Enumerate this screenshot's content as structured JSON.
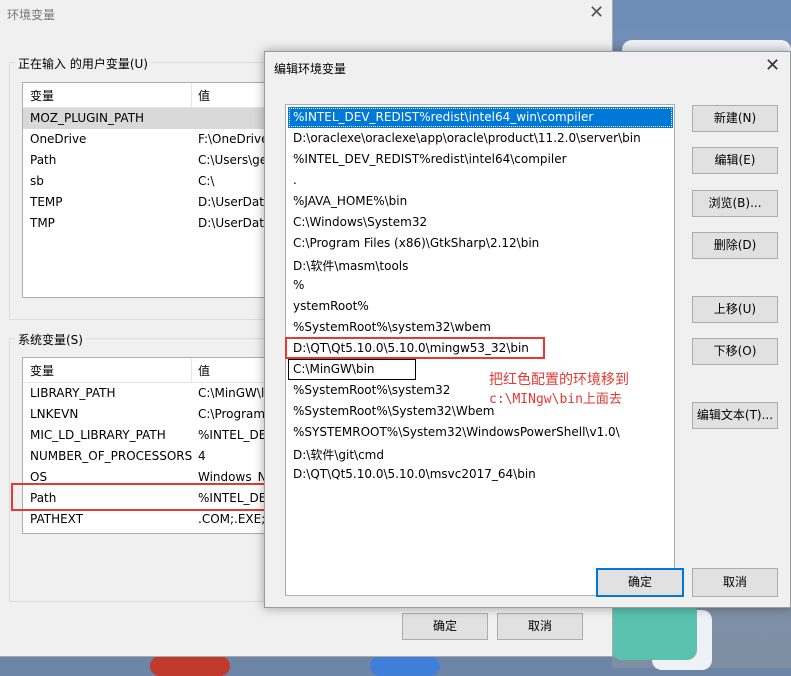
{
  "background_window": {
    "title": "环境变量",
    "close_glyph": "✕",
    "user_group_label": "正在输入 的用户变量(U)",
    "system_group_label": "系统变量(S)",
    "col_variable": "变量",
    "col_value": "值",
    "user_vars": [
      {
        "name": "MOZ_PLUGIN_PATH",
        "value": ""
      },
      {
        "name": "OneDrive",
        "value": "F:\\OneDrive"
      },
      {
        "name": "Path",
        "value": "C:\\Users\\ge"
      },
      {
        "name": "sb",
        "value": "C:\\"
      },
      {
        "name": "TEMP",
        "value": "D:\\UserData"
      },
      {
        "name": "TMP",
        "value": "D:\\UserData"
      }
    ],
    "system_vars": [
      {
        "name": "LIBRARY_PATH",
        "value": "C:\\MinGW\\l"
      },
      {
        "name": "LNKEVN",
        "value": "C:\\Program"
      },
      {
        "name": "MIC_LD_LIBRARY_PATH",
        "value": "%INTEL_DE"
      },
      {
        "name": "NUMBER_OF_PROCESSORS",
        "value": "4"
      },
      {
        "name": "OS",
        "value": "Windows_N"
      },
      {
        "name": "Path",
        "value": "%INTEL_DE"
      },
      {
        "name": "PATHEXT",
        "value": ".COM;.EXE;."
      }
    ],
    "ok_label": "确定",
    "cancel_label": "取消"
  },
  "dialog": {
    "title": "编辑环境变量",
    "close_glyph": "✕",
    "paths": [
      "%INTEL_DEV_REDIST%redist\\intel64_win\\compiler",
      "D:\\oraclexe\\oraclexe\\app\\oracle\\product\\11.2.0\\server\\bin",
      "%INTEL_DEV_REDIST%redist\\intel64\\compiler",
      ".",
      "%JAVA_HOME%\\bin",
      "C:\\Windows\\System32",
      "C:\\Program Files (x86)\\GtkSharp\\2.12\\bin",
      "D:\\软件\\masm\\tools",
      "%",
      "ystemRoot%",
      "%SystemRoot%\\system32\\wbem",
      "D:\\QT\\Qt5.10.0\\5.10.0\\mingw53_32\\bin",
      "C:\\MinGW\\bin",
      "%SystemRoot%\\system32",
      "%SystemRoot%\\System32\\Wbem",
      "%SYSTEMROOT%\\System32\\WindowsPowerShell\\v1.0\\",
      "D:\\软件\\git\\cmd",
      "D:\\QT\\Qt5.10.0\\5.10.0\\msvc2017_64\\bin"
    ],
    "buttons": {
      "new": "新建(N)",
      "edit": "编辑(E)",
      "browse": "浏览(B)...",
      "delete": "删除(D)",
      "move_up": "上移(U)",
      "move_down": "下移(O)",
      "edit_text": "编辑文本(T)...",
      "ok": "确定",
      "cancel": "取消"
    },
    "annotation_line1": "把红色配置的环境移到",
    "annotation_line2": "c:\\MINgw\\bin上面去"
  },
  "colors": {
    "selection": "#0078d7",
    "highlight_box": "#e53935"
  }
}
